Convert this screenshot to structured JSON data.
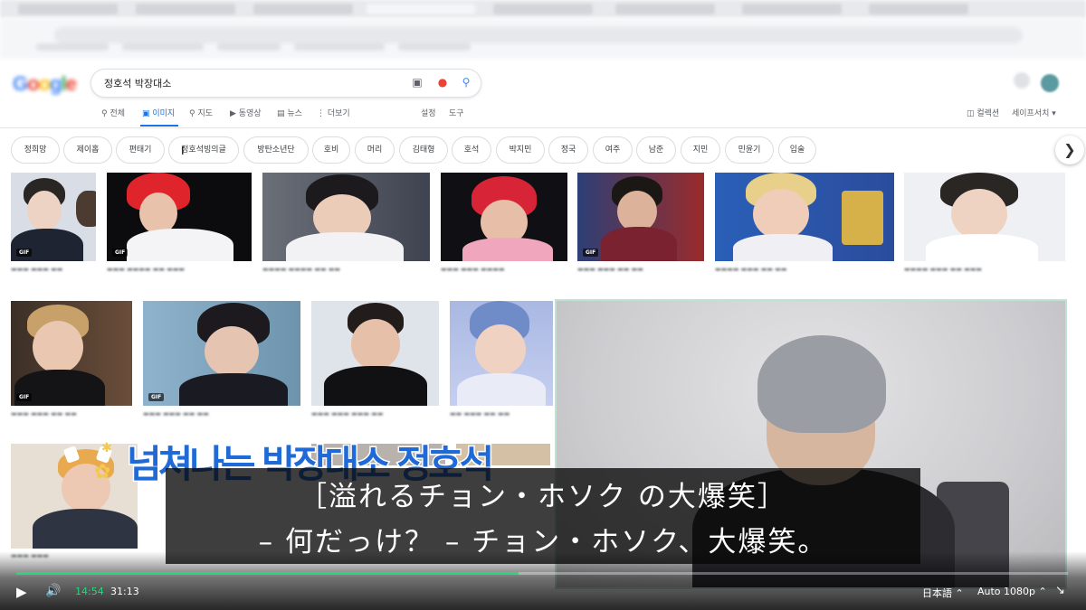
{
  "search": {
    "query": "정호석 박장대소"
  },
  "nav": {
    "items": [
      "전체",
      "이미지",
      "지도",
      "동영상",
      "뉴스",
      "더보기"
    ],
    "settings": "설정",
    "tools": "도구",
    "collections": "컬렉션",
    "safesearch": "세이프서치 ▾"
  },
  "chips": [
    "정희망",
    "제이홉",
    "편태기",
    "정호석빙의글",
    "방탄소년단",
    "호비",
    "머리",
    "김태형",
    "호석",
    "박지민",
    "정국",
    "여주",
    "남준",
    "지민",
    "민윤기",
    "입술"
  ],
  "badge": {
    "gif": "GIF"
  },
  "sticker_text": "넘쳐나는 박장대소 정호석",
  "subtitles": {
    "line1": "［溢れるチョン・ホソク の大爆笑］",
    "line2": "– 何だっけ？ – チョン・ホソク、大爆笑。"
  },
  "player": {
    "current_time": "14:54",
    "duration": "31:13",
    "progress": 0.4774,
    "language": "日本語",
    "quality": "Auto 1080p"
  }
}
